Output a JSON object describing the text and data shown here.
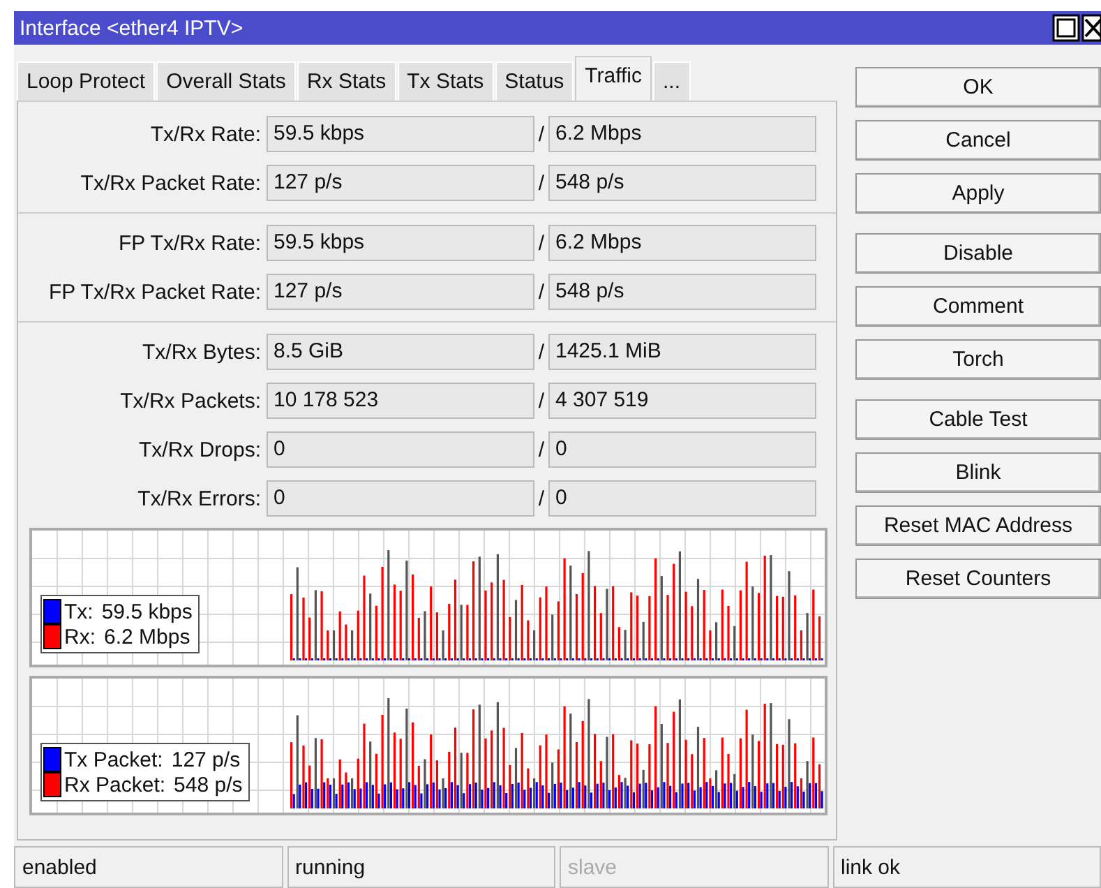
{
  "window": {
    "title": "Interface <ether4 IPTV>"
  },
  "tabs": [
    {
      "label": "Loop Protect",
      "selected": false
    },
    {
      "label": "Overall Stats",
      "selected": false
    },
    {
      "label": "Rx Stats",
      "selected": false
    },
    {
      "label": "Tx Stats",
      "selected": false
    },
    {
      "label": "Status",
      "selected": false
    },
    {
      "label": "Traffic",
      "selected": true
    },
    {
      "label": "...",
      "selected": false
    }
  ],
  "groups": [
    [
      {
        "label": "Tx/Rx Rate:",
        "tx": "59.5 kbps",
        "separator": "/",
        "rx": "6.2 Mbps"
      },
      {
        "label": "Tx/Rx Packet Rate:",
        "tx": "127 p/s",
        "separator": "/",
        "rx": "548 p/s"
      }
    ],
    [
      {
        "label": "FP Tx/Rx Rate:",
        "tx": "59.5 kbps",
        "separator": "/",
        "rx": "6.2 Mbps"
      },
      {
        "label": "FP Tx/Rx Packet Rate:",
        "tx": "127 p/s",
        "separator": "/",
        "rx": "548 p/s"
      }
    ],
    [
      {
        "label": "Tx/Rx Bytes:",
        "tx": "8.5 GiB",
        "separator": "/",
        "rx": "1425.1 MiB"
      },
      {
        "label": "Tx/Rx Packets:",
        "tx": "10 178 523",
        "separator": "/",
        "rx": "4 307 519"
      },
      {
        "label": "Tx/Rx Drops:",
        "tx": "0",
        "separator": "/",
        "rx": "0"
      },
      {
        "label": "Tx/Rx Errors:",
        "tx": "0",
        "separator": "/",
        "rx": "0"
      }
    ]
  ],
  "graphs": [
    {
      "kind": "bits",
      "legend": [
        {
          "name": "Tx:",
          "value": "59.5 kbps",
          "color": "#0000ff"
        },
        {
          "name": "Rx:",
          "value": "6.2 Mbps",
          "color": "#ff0000"
        }
      ]
    },
    {
      "kind": "packets",
      "legend": [
        {
          "name": "Tx Packet:",
          "value": "127 p/s",
          "color": "#0000ff"
        },
        {
          "name": "Rx Packet:",
          "value": "548 p/s",
          "color": "#ff0000"
        }
      ]
    }
  ],
  "button_groups": [
    [
      "OK",
      "Cancel",
      "Apply"
    ],
    [
      "Disable",
      "Comment",
      "Torch"
    ],
    [
      "Cable Test",
      "Blink",
      "Reset MAC Address",
      "Reset Counters"
    ]
  ],
  "status_bar": [
    {
      "text": "enabled",
      "disabled": false
    },
    {
      "text": "running",
      "disabled": false
    },
    {
      "text": "slave",
      "disabled": true
    },
    {
      "text": "link ok",
      "disabled": false
    }
  ]
}
